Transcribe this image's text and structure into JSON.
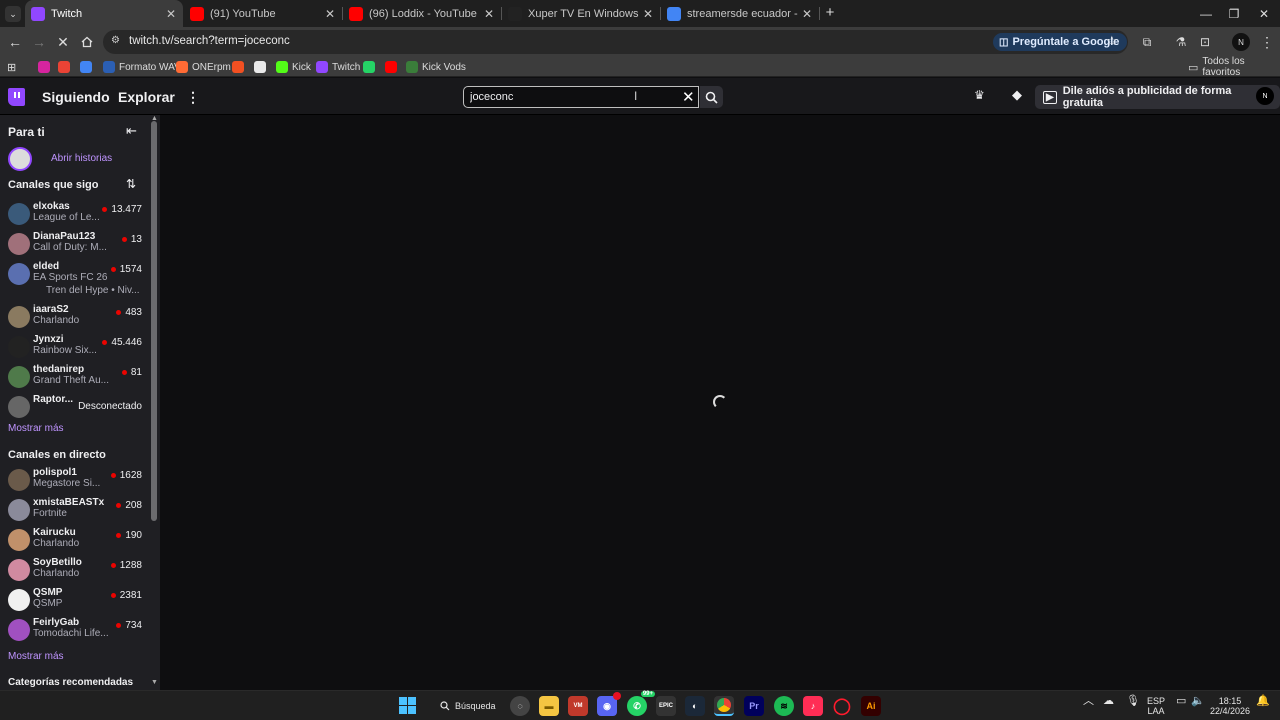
{
  "browser": {
    "tabs": [
      {
        "title": "Twitch",
        "icon": "twitch-icon",
        "color": "#9147ff",
        "active": true
      },
      {
        "title": "(91) YouTube",
        "icon": "youtube-icon",
        "color": "#ff0000"
      },
      {
        "title": "(96) Loddix - YouTube",
        "icon": "youtube-icon",
        "color": "#ff0000"
      },
      {
        "title": "Xuper TV En Windows PC: Guía",
        "icon": "xuper-icon",
        "color": "#222222"
      },
      {
        "title": "streamersde ecuador - Buscar co",
        "icon": "google-icon",
        "color": "#4285f4"
      }
    ],
    "url": "twitch.tv/search?term=joceconc",
    "ask_google": "Pregúntale a Google",
    "bookmarks": [
      {
        "label": "",
        "icon": "instagram-icon"
      },
      {
        "label": "",
        "icon": "gmail-icon"
      },
      {
        "label": "",
        "icon": "bookmark-icon"
      },
      {
        "label": "Formato WAV",
        "icon": "formato-icon"
      },
      {
        "label": "ONErpm",
        "icon": "onerpm-icon"
      },
      {
        "label": "",
        "icon": "microsoft-icon"
      },
      {
        "label": "",
        "icon": "chatgpt-icon"
      },
      {
        "label": "Kick",
        "icon": "kick-icon"
      },
      {
        "label": "Twitch",
        "icon": "twitch-icon"
      },
      {
        "label": "",
        "icon": "whatsapp-icon"
      },
      {
        "label": "",
        "icon": "youtube-icon"
      },
      {
        "label": "Kick Vods",
        "icon": "kick-vods-icon"
      }
    ],
    "all_bookmarks": "Todos los favoritos"
  },
  "twitch": {
    "nav": {
      "following": "Siguiendo",
      "browse": "Explorar",
      "search_value": "joceconc",
      "ad_button": "Dile adiós a publicidad de forma gratuita",
      "avatar_text": "N"
    },
    "sidebar": {
      "for_you": "Para ti",
      "stories": "Abrir historias",
      "followed_header": "Canales que sigo",
      "followed": [
        {
          "name": "elxokas",
          "game": "League of Le...",
          "viewers": "13.477",
          "color": "#3a5a7a"
        },
        {
          "name": "DianaPau123",
          "game": "Call of Duty: M...",
          "viewers": "13",
          "color": "#a0707a"
        },
        {
          "name": "elded",
          "game": "EA Sports FC 26",
          "viewers": "1574",
          "color": "#5a6fb0",
          "extra": "Tren del Hype • Niv..."
        },
        {
          "name": "iaaraS2",
          "game": "Charlando",
          "viewers": "483",
          "color": "#8a7a60"
        },
        {
          "name": "Jynxzi",
          "game": "Rainbow Six...",
          "viewers": "45.446",
          "color": "#222222"
        },
        {
          "name": "thedanirep",
          "game": "Grand Theft Au...",
          "viewers": "81",
          "color": "#4f7a4a"
        },
        {
          "name": "Raptor...",
          "game": "",
          "viewers": "Desconectado",
          "color": "#666666",
          "offline": true
        }
      ],
      "show_more_1": "Mostrar más",
      "live_header": "Canales en directo",
      "live": [
        {
          "name": "polispol1",
          "game": "Megastore Si...",
          "viewers": "1628",
          "color": "#6a5a4a"
        },
        {
          "name": "xmistaBEASTx",
          "game": "Fortnite",
          "viewers": "208",
          "color": "#8a8a9a"
        },
        {
          "name": "Kairucku",
          "game": "Charlando",
          "viewers": "190",
          "color": "#c0906a"
        },
        {
          "name": "SoyBetillo",
          "game": "Charlando",
          "viewers": "1288",
          "color": "#d08aa0"
        },
        {
          "name": "QSMP",
          "game": "QSMP",
          "viewers": "2381",
          "color": "#f0f0f0"
        },
        {
          "name": "FeirlyGab",
          "game": "Tomodachi Life...",
          "viewers": "734",
          "color": "#a050c0"
        }
      ],
      "show_more_2": "Mostrar más",
      "categories_header": "Categorías recomendadas"
    }
  },
  "taskbar": {
    "search": "Búsqueda",
    "lang": "ESP",
    "lang2": "LAA",
    "time": "18:15",
    "date": "22/4/2026",
    "badges": {
      "discord": "",
      "whatsapp": "99+"
    }
  }
}
